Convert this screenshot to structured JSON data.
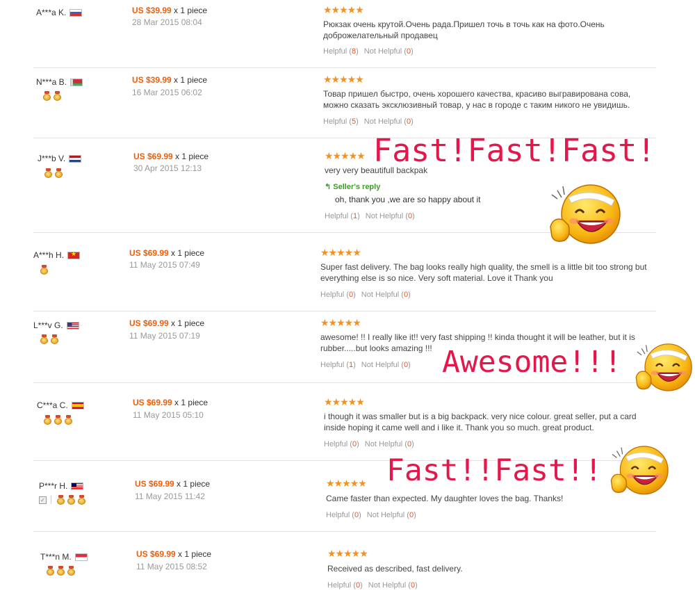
{
  "reviews": [
    {
      "name": "A***a K.",
      "flag": "ru",
      "medals": 0,
      "price": "US $39.99",
      "qty": " x 1 piece",
      "date": "28 Mar 2015 08:04",
      "text": "Рюкзак очень крутой.Очень рада.Пришел точь в точь как на фото.Очень доброжелательный продавец",
      "helpful": "8",
      "not_helpful": "0"
    },
    {
      "name": "N***a B.",
      "flag": "by",
      "medals": 2,
      "price": "US $39.99",
      "qty": " x 1 piece",
      "date": "16 Mar 2015 06:02",
      "text": "Товар пришел быстро, очень хорошего качества, красиво выгравирована сова, можно сказать эксклюзивный товар, у нас в городе с таким никого не увидишь.",
      "helpful": "5",
      "not_helpful": "0"
    },
    {
      "name": "J***b V.",
      "flag": "nl",
      "medals": 2,
      "price": "US $69.99",
      "qty": " x 1 piece",
      "date": "30 Apr 2015 12:13",
      "text": "very very beautifull backpak",
      "reply_label": "Seller's reply",
      "reply_arrow": "↰",
      "reply_text": "oh, thank you ,we are so happy about it",
      "helpful": "1",
      "not_helpful": "0"
    },
    {
      "name": "A***h H.",
      "flag": "vn",
      "medals": 1,
      "price": "US $69.99",
      "qty": " x 1 piece",
      "date": "11 May 2015 07:49",
      "text": "Super fast delivery. The bag looks really high quality, the smell is a little bit too strong but everything else is so nice. Very soft material. Love it Thank you",
      "helpful": "0",
      "not_helpful": "0"
    },
    {
      "name": "L***v G.",
      "flag": "us",
      "medals": 2,
      "price": "US $69.99",
      "qty": " x 1 piece",
      "date": "11 May 2015 07:19",
      "text": "awesome! !! I really like it!! very fast shipping !! kinda thought it will be leather, but it is rubber.....but looks amazing !!!",
      "helpful": "1",
      "not_helpful": "0"
    },
    {
      "name": "C***a C.",
      "flag": "es",
      "medals": 3,
      "price": "US $69.99",
      "qty": " x 1 piece",
      "date": "11 May 2015 05:10",
      "text": "i though it was smaller but is a big backpack. very nice colour. great seller, put a card inside hoping it came well and i like it. Thank you so much. great product.",
      "helpful": "0",
      "not_helpful": "0"
    },
    {
      "name": "P***r H.",
      "flag": "my",
      "medals": 3,
      "price": "US $69.99",
      "qty": " x 1 piece",
      "date": "11 May 2015 11:42",
      "text": "Came faster than expected. My daughter loves the bag. Thanks!",
      "helpful": "0",
      "not_helpful": "0"
    },
    {
      "name": "T***n M.",
      "flag": "sg",
      "medals": 3,
      "price": "US $69.99",
      "qty": " x 1 piece",
      "date": "11 May 2015 08:52",
      "text": "Received as described, fast delivery.",
      "helpful": "0",
      "not_helpful": "0"
    }
  ],
  "labels": {
    "helpful": "Helpful",
    "not_helpful": "Not Helpful",
    "stars": "★★★★★"
  },
  "overlays": {
    "fast1": "Fast!Fast!Fast!",
    "awesome": "Awesome!!!",
    "fast2": "Fast!!Fast!!"
  },
  "colors": {
    "price": "#f25c05",
    "star": "#f5911e",
    "overlay": "#e3174a",
    "reply": "#3a9d23"
  }
}
